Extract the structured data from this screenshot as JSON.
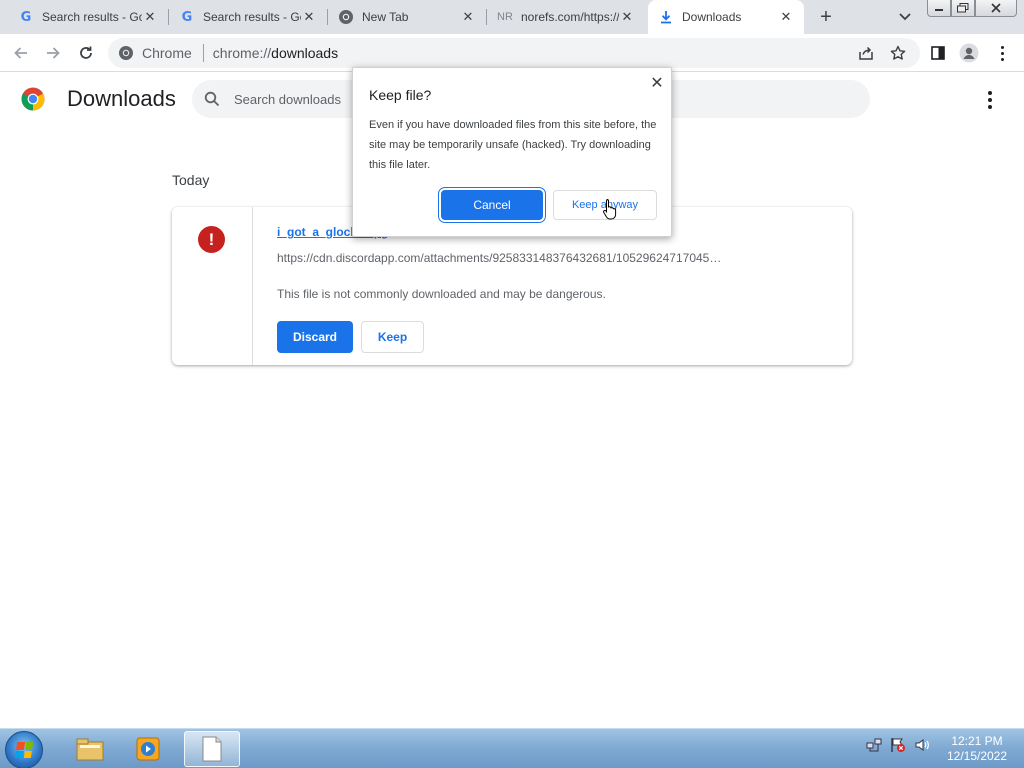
{
  "tabs": [
    {
      "title": "Search results - Google Search",
      "icon": "google-icon",
      "active": false
    },
    {
      "title": "Search results - Google Search",
      "icon": "google-icon",
      "active": false
    },
    {
      "title": "New Tab",
      "icon": "chrome-icon",
      "active": false
    },
    {
      "title": "norefs.com/https://",
      "icon": "nr-icon",
      "icon_text": "NR",
      "active": false
    },
    {
      "title": "Downloads",
      "icon": "download-icon",
      "active": true
    }
  ],
  "omnibox": {
    "chip_label": "Chrome",
    "url_scheme": "chrome://",
    "url_host": "downloads"
  },
  "page": {
    "title": "Downloads",
    "search_placeholder": "Search downloads",
    "section_label": "Today"
  },
  "download": {
    "file_name": "i_got_a_glock_...pg",
    "url": "https://cdn.discordapp.com/attachments/925833148376432681/10529624717045…",
    "warning": "This file is not commonly downloaded and may be dangerous.",
    "discard_label": "Discard",
    "keep_label": "Keep",
    "warning_icon_text": "!"
  },
  "dialog": {
    "title": "Keep file?",
    "body": "Even if you have downloaded files from this site before, the site may be temporarily unsafe (hacked). Try downloading this file later.",
    "cancel_label": "Cancel",
    "keep_anyway_label": "Keep anyway",
    "close_glyph": "✕"
  },
  "taskbar": {
    "time": "12:21 PM",
    "date": "12/15/2022"
  },
  "colors": {
    "accent": "#1a73e8",
    "danger": "#c5221f",
    "tabstrip": "#dee1e6"
  }
}
